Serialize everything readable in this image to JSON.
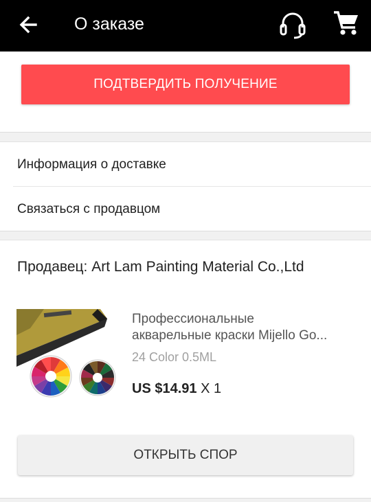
{
  "header": {
    "title": "О заказе",
    "back_icon": "arrow-left-icon",
    "support_icon": "headset-icon",
    "cart_icon": "shopping-cart-icon"
  },
  "actions": {
    "confirm_label": "ПОДТВЕРДИТЬ ПОЛУЧЕНИЕ",
    "confirm_color": "#ff4b4f"
  },
  "links": {
    "delivery_info": "Информация о доставке",
    "contact_seller": "Связаться с продавцом"
  },
  "order": {
    "seller": "Продавец: Art Lam Painting Material Co.,Ltd",
    "product": {
      "name_line1": "Профессиональные",
      "name_line2": "акварельные краски Mijello Go...",
      "variant": "24 Color 0.5ML",
      "price": "US $14.91",
      "quantity": "X 1"
    },
    "dispute_label": "ОТКРЫТЬ СПОР"
  }
}
